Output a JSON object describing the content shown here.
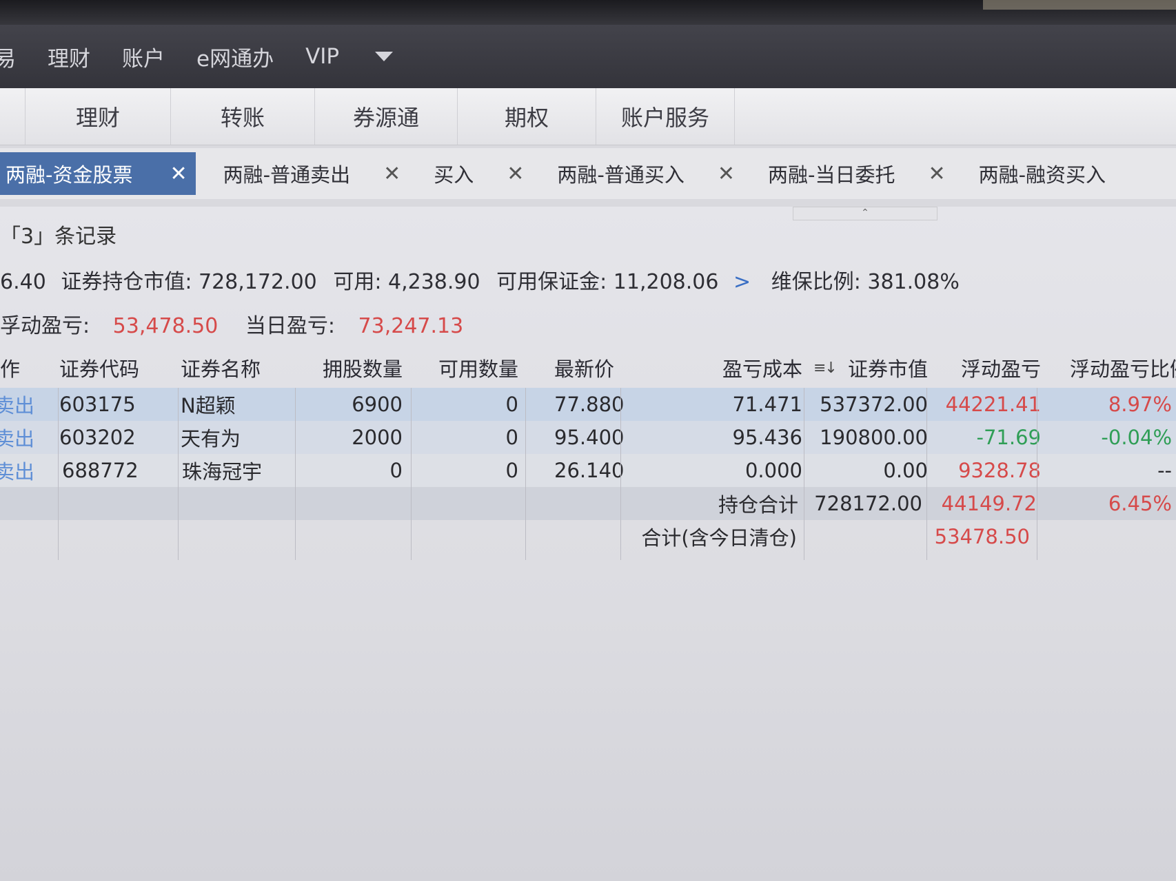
{
  "menu": {
    "items": [
      "易",
      "理财",
      "账户",
      "e网通办",
      "VIP"
    ]
  },
  "subnav": {
    "items": [
      "理财",
      "转账",
      "券源通",
      "期权",
      "账户服务"
    ]
  },
  "tabs": [
    {
      "label": "两融-资金股票",
      "close": "✕",
      "active": true
    },
    {
      "label": "两融-普通卖出",
      "close": "✕"
    },
    {
      "label": "买入",
      "close": "✕"
    },
    {
      "label": "两融-普通买入",
      "close": "✕"
    },
    {
      "label": "两融-当日委托",
      "close": "✕"
    },
    {
      "label": "两融-融资买入",
      "close": ""
    }
  ],
  "records_text": "「3」条记录",
  "summary": {
    "prefix_value": "6.40",
    "market_value_label": "证券持仓市值:",
    "market_value": "728,172.00",
    "available_label": "可用:",
    "available": "4,238.90",
    "margin_label": "可用保证金:",
    "margin": "11,208.06",
    "arrow": ">",
    "ratio_label": "维保比例:",
    "ratio": "381.08%",
    "float_pl_label": "浮动盈亏:",
    "float_pl_label_partial": "孚动盈亏:",
    "float_pl": "53,478.50",
    "day_pl_label": "当日盈亏:",
    "day_pl": "73,247.13"
  },
  "table": {
    "headers": {
      "op": "作",
      "code": "证券代码",
      "name": "证券名称",
      "hold": "拥股数量",
      "avail": "可用数量",
      "price": "最新价",
      "cost": "盈亏成本",
      "mv": "证券市值",
      "pl": "浮动盈亏",
      "plr": "浮动盈亏比例"
    },
    "rows": [
      {
        "op": "卖出",
        "code": "603175",
        "name": "N超颖",
        "hold": "6900",
        "avail": "0",
        "price": "77.880",
        "cost": "71.471",
        "mv": "537372.00",
        "pl": "44221.41",
        "plr": "8.97%"
      },
      {
        "op": "卖出",
        "code": "603202",
        "name": "天有为",
        "hold": "2000",
        "avail": "0",
        "price": "95.400",
        "cost": "95.436",
        "mv": "190800.00",
        "pl": "-71.69",
        "plr": "-0.04%"
      },
      {
        "op": "卖出",
        "code": "688772",
        "name": "珠海冠宇",
        "hold": "0",
        "avail": "0",
        "price": "26.140",
        "cost": "0.000",
        "mv": "0.00",
        "pl": "9328.78",
        "plr": "--"
      }
    ],
    "total": {
      "label": "持仓合计",
      "mv": "728172.00",
      "pl": "44149.72",
      "plr": "6.45%"
    },
    "sum": {
      "label": "合计(含今日清仓)",
      "pl": "53478.50"
    }
  },
  "colors": {
    "profit": "#d64a4a",
    "loss": "#2f9e56",
    "accent": "#4a6fa8",
    "link": "#5f8fd6"
  }
}
